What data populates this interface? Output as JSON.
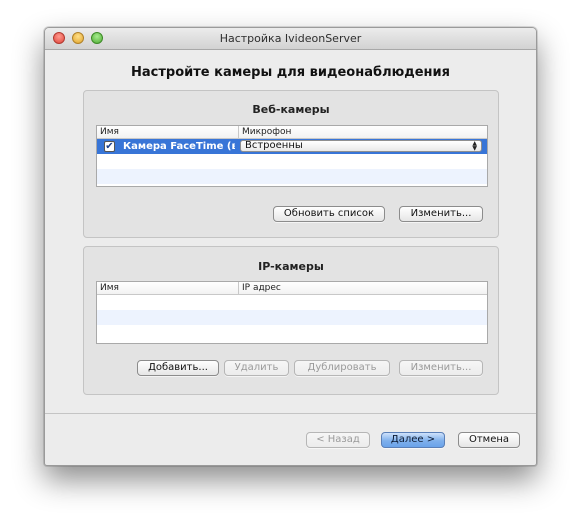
{
  "window": {
    "title": "Настройка IvideonServer",
    "heading": "Настройте камеры для видеонаблюдения"
  },
  "webcams": {
    "title": "Веб-камеры",
    "columns": [
      "Имя",
      "Микрофон"
    ],
    "rows": [
      {
        "checked": true,
        "name": "Камера FaceTime (в...",
        "microphone": "Встроенны"
      }
    ],
    "refresh_label": "Обновить список",
    "edit_label": "Изменить..."
  },
  "ipcams": {
    "title": "IP-камеры",
    "columns": [
      "Имя",
      "IP адрес"
    ],
    "rows": [],
    "add_label": "Добавить...",
    "delete_label": "Удалить",
    "duplicate_label": "Дублировать",
    "edit_label": "Изменить..."
  },
  "footer": {
    "back_label": "< Назад",
    "next_label": "Далее >",
    "cancel_label": "Отмена"
  }
}
